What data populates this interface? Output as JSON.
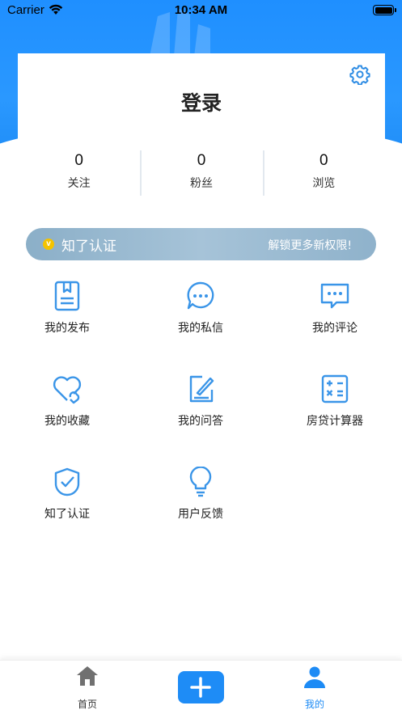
{
  "status_bar": {
    "carrier": "Carrier",
    "time": "10:34 AM"
  },
  "colors": {
    "accent": "#1e8cf6",
    "icon_blue": "#3a95e8",
    "banner": "#9ab9d0"
  },
  "profile": {
    "title": "登录",
    "settings_icon": "gear-icon",
    "stats": [
      {
        "value": "0",
        "label": "关注"
      },
      {
        "value": "0",
        "label": "粉丝"
      },
      {
        "value": "0",
        "label": "浏览"
      }
    ]
  },
  "banner": {
    "badge": "v",
    "title": "知了认证",
    "subtitle": "解锁更多新权限!"
  },
  "menu": [
    {
      "label": "我的发布",
      "icon": "book-icon"
    },
    {
      "label": "我的私信",
      "icon": "chat-bubble-icon"
    },
    {
      "label": "我的评论",
      "icon": "comment-icon"
    },
    {
      "label": "我的收藏",
      "icon": "heart-icon"
    },
    {
      "label": "我的问答",
      "icon": "edit-icon"
    },
    {
      "label": "房贷计算器",
      "icon": "calculator-icon"
    },
    {
      "label": "知了认证",
      "icon": "shield-check-icon"
    },
    {
      "label": "用户反馈",
      "icon": "lightbulb-icon"
    }
  ],
  "tabbar": {
    "home_label": "首页",
    "add_icon": "plus-icon",
    "mine_label": "我的"
  }
}
